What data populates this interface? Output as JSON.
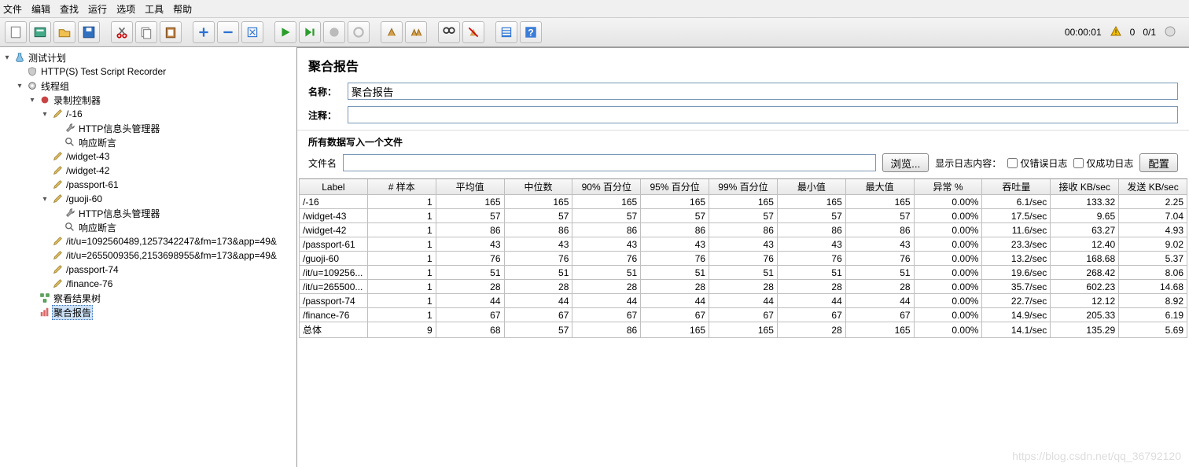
{
  "menu": [
    "文件",
    "编辑",
    "查找",
    "运行",
    "选项",
    "工具",
    "帮助"
  ],
  "status": {
    "time": "00:00:01",
    "warnings": "0",
    "threads": "0/1"
  },
  "tree": [
    {
      "d": 0,
      "t": "toggle",
      "icon": "flask",
      "label": "测试计划"
    },
    {
      "d": 1,
      "t": "leaf",
      "icon": "shield",
      "label": "HTTP(S) Test Script Recorder"
    },
    {
      "d": 1,
      "t": "toggle",
      "icon": "gear",
      "label": "线程组"
    },
    {
      "d": 2,
      "t": "toggle",
      "icon": "rec",
      "label": "录制控制器"
    },
    {
      "d": 3,
      "t": "toggle",
      "icon": "pipette",
      "label": "/-16"
    },
    {
      "d": 4,
      "t": "leaf",
      "icon": "wrench",
      "label": "HTTP信息头管理器"
    },
    {
      "d": 4,
      "t": "leaf",
      "icon": "magnify",
      "label": "响应断言"
    },
    {
      "d": 3,
      "t": "leaf",
      "icon": "pipette",
      "label": "/widget-43"
    },
    {
      "d": 3,
      "t": "leaf",
      "icon": "pipette",
      "label": "/widget-42"
    },
    {
      "d": 3,
      "t": "leaf",
      "icon": "pipette",
      "label": "/passport-61"
    },
    {
      "d": 3,
      "t": "toggle",
      "icon": "pipette",
      "label": "/guoji-60"
    },
    {
      "d": 4,
      "t": "leaf",
      "icon": "wrench",
      "label": "HTTP信息头管理器"
    },
    {
      "d": 4,
      "t": "leaf",
      "icon": "magnify",
      "label": "响应断言"
    },
    {
      "d": 3,
      "t": "leaf",
      "icon": "pipette",
      "label": "/it/u=1092560489,1257342247&fm=173&app=49&"
    },
    {
      "d": 3,
      "t": "leaf",
      "icon": "pipette",
      "label": "/it/u=2655009356,2153698955&fm=173&app=49&"
    },
    {
      "d": 3,
      "t": "leaf",
      "icon": "pipette",
      "label": "/passport-74"
    },
    {
      "d": 3,
      "t": "leaf",
      "icon": "pipette",
      "label": "/finance-76"
    },
    {
      "d": 2,
      "t": "leaf",
      "icon": "tree",
      "label": "察看结果树"
    },
    {
      "d": 2,
      "t": "leaf",
      "icon": "chart",
      "label": "聚合报告",
      "selected": true
    }
  ],
  "panel": {
    "title": "聚合报告",
    "labels": {
      "name": "名称：",
      "comment": "注释：",
      "allDataFile": "所有数据写入一个文件",
      "filename": "文件名",
      "browse": "浏览...",
      "showLog": "显示日志内容：",
      "errorsOnly": "仅错误日志",
      "successOnly": "仅成功日志",
      "configure": "配置"
    },
    "values": {
      "name": "聚合报告",
      "comment": "",
      "filename": ""
    }
  },
  "table": {
    "headers": [
      "Label",
      "# 样本",
      "平均值",
      "中位数",
      "90% 百分位",
      "95% 百分位",
      "99% 百分位",
      "最小值",
      "最大值",
      "异常 %",
      "吞吐量",
      "接收 KB/sec",
      "发送 KB/sec"
    ],
    "rows": [
      [
        "/-16",
        "1",
        "165",
        "165",
        "165",
        "165",
        "165",
        "165",
        "165",
        "0.00%",
        "6.1/sec",
        "133.32",
        "2.25"
      ],
      [
        "/widget-43",
        "1",
        "57",
        "57",
        "57",
        "57",
        "57",
        "57",
        "57",
        "0.00%",
        "17.5/sec",
        "9.65",
        "7.04"
      ],
      [
        "/widget-42",
        "1",
        "86",
        "86",
        "86",
        "86",
        "86",
        "86",
        "86",
        "0.00%",
        "11.6/sec",
        "63.27",
        "4.93"
      ],
      [
        "/passport-61",
        "1",
        "43",
        "43",
        "43",
        "43",
        "43",
        "43",
        "43",
        "0.00%",
        "23.3/sec",
        "12.40",
        "9.02"
      ],
      [
        "/guoji-60",
        "1",
        "76",
        "76",
        "76",
        "76",
        "76",
        "76",
        "76",
        "0.00%",
        "13.2/sec",
        "168.68",
        "5.37"
      ],
      [
        "/it/u=109256...",
        "1",
        "51",
        "51",
        "51",
        "51",
        "51",
        "51",
        "51",
        "0.00%",
        "19.6/sec",
        "268.42",
        "8.06"
      ],
      [
        "/it/u=265500...",
        "1",
        "28",
        "28",
        "28",
        "28",
        "28",
        "28",
        "28",
        "0.00%",
        "35.7/sec",
        "602.23",
        "14.68"
      ],
      [
        "/passport-74",
        "1",
        "44",
        "44",
        "44",
        "44",
        "44",
        "44",
        "44",
        "0.00%",
        "22.7/sec",
        "12.12",
        "8.92"
      ],
      [
        "/finance-76",
        "1",
        "67",
        "67",
        "67",
        "67",
        "67",
        "67",
        "67",
        "0.00%",
        "14.9/sec",
        "205.33",
        "6.19"
      ],
      [
        "总体",
        "9",
        "68",
        "57",
        "86",
        "165",
        "165",
        "28",
        "165",
        "0.00%",
        "14.1/sec",
        "135.29",
        "5.69"
      ]
    ]
  },
  "watermark": "https://blog.csdn.net/qq_36792120"
}
